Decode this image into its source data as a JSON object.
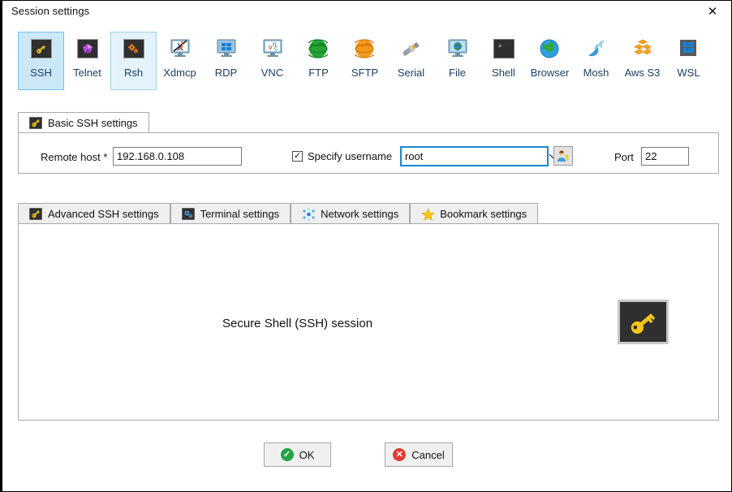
{
  "window": {
    "title": "Session settings",
    "close_label": "✕",
    "close_icon": "close-icon"
  },
  "session_types": [
    {
      "label": "SSH",
      "icon": "ssh-key-icon",
      "state": "selected"
    },
    {
      "label": "Telnet",
      "icon": "telnet-gem-icon",
      "state": "normal"
    },
    {
      "label": "Rsh",
      "icon": "rsh-gears-icon",
      "state": "hovered"
    },
    {
      "label": "Xdmcp",
      "icon": "xdmcp-monitor-icon",
      "state": "normal"
    },
    {
      "label": "RDP",
      "icon": "rdp-windows-icon",
      "state": "normal"
    },
    {
      "label": "VNC",
      "icon": "vnc-monitor-icon",
      "state": "normal"
    },
    {
      "label": "FTP",
      "icon": "ftp-globe-icon",
      "state": "normal"
    },
    {
      "label": "SFTP",
      "icon": "sftp-globe-icon",
      "state": "normal"
    },
    {
      "label": "Serial",
      "icon": "serial-plug-icon",
      "state": "normal"
    },
    {
      "label": "File",
      "icon": "file-monitor-icon",
      "state": "normal"
    },
    {
      "label": "Shell",
      "icon": "shell-console-icon",
      "state": "normal"
    },
    {
      "label": "Browser",
      "icon": "browser-globe-icon",
      "state": "normal"
    },
    {
      "label": "Mosh",
      "icon": "mosh-satellite-icon",
      "state": "normal"
    },
    {
      "label": "Aws S3",
      "icon": "aws-s3-cubes-icon",
      "state": "normal"
    },
    {
      "label": "WSL",
      "icon": "wsl-windows-icon",
      "state": "normal"
    }
  ],
  "basic_tab": {
    "label": "Basic SSH settings",
    "icon": "key-icon"
  },
  "form": {
    "remote_host_label": "Remote host *",
    "remote_host_value": "192.168.0.108",
    "remote_host_placeholder": "",
    "specify_username_label": "Specify username",
    "specify_username_checked": true,
    "check_glyph": "✓",
    "username_value": "root",
    "username_placeholder": "",
    "dropdown_glyph": "⌄",
    "pick_user_icon": "user-key-icon",
    "port_label": "Port",
    "port_value": "22",
    "spin_up_glyph": "▲",
    "spin_down_glyph": "▼"
  },
  "detail_tabs": [
    {
      "label": "Advanced SSH settings",
      "icon": "key-icon",
      "active": false
    },
    {
      "label": "Terminal settings",
      "icon": "gears-icon",
      "active": false
    },
    {
      "label": "Network settings",
      "icon": "network-icon",
      "active": false
    },
    {
      "label": "Bookmark settings",
      "icon": "star-icon",
      "active": false
    }
  ],
  "detail_panel": {
    "description": "Secure Shell (SSH) session",
    "big_icon": "ssh-key-icon"
  },
  "footer": {
    "ok_label": "OK",
    "ok_glyph": "✓",
    "cancel_label": "Cancel",
    "cancel_glyph": "✕"
  },
  "colors": {
    "selected_tile": "#cce8f7",
    "hovered_tile": "#e4f2fb",
    "focus_border": "#1a86d0",
    "key_yellow": "#f5c518",
    "ok_green": "#22a447",
    "cancel_red": "#e23b33",
    "label_blue": "#1c3f66"
  }
}
